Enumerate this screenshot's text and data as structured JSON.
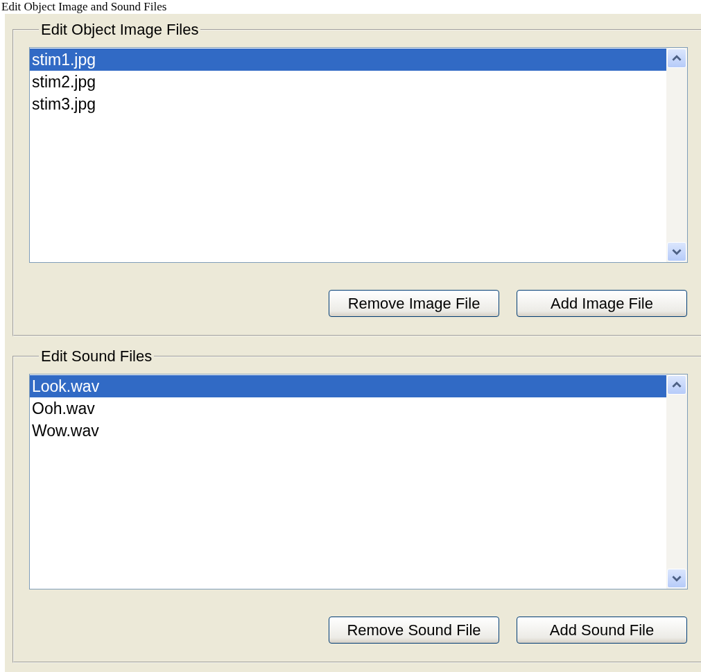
{
  "title": "Edit Object Image and Sound Files",
  "groups": [
    {
      "legend": "Edit Object Image Files",
      "items": [
        {
          "label": "stim1.jpg",
          "selected": true
        },
        {
          "label": "stim2.jpg",
          "selected": false
        },
        {
          "label": "stim3.jpg",
          "selected": false
        }
      ],
      "buttons": [
        "Remove Image File",
        "Add Image File"
      ]
    },
    {
      "legend": "Edit Sound Files",
      "items": [
        {
          "label": "Look.wav",
          "selected": true
        },
        {
          "label": "Ooh.wav",
          "selected": false
        },
        {
          "label": "Wow.wav",
          "selected": false
        }
      ],
      "buttons": [
        "Remove Sound File",
        "Add Sound File"
      ]
    }
  ]
}
